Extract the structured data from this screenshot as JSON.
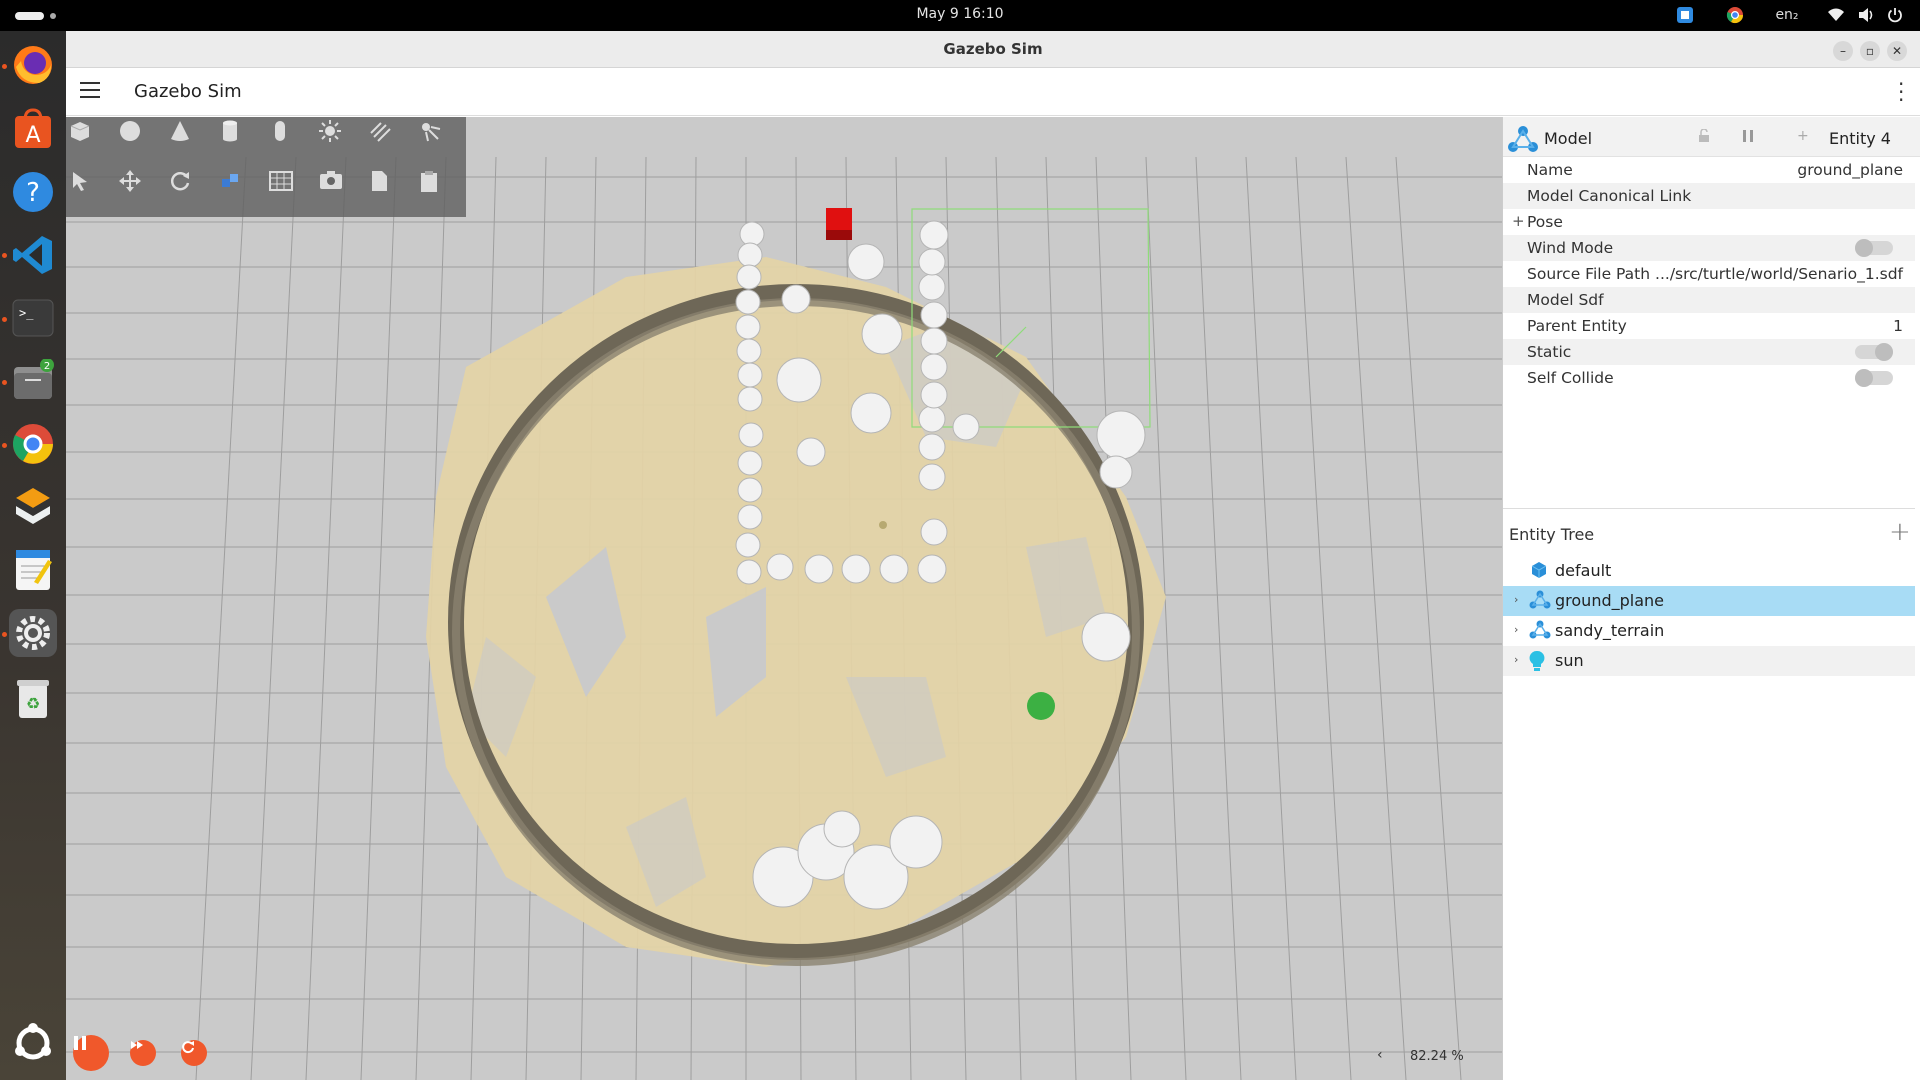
{
  "topbar": {
    "clock": "May 9  16:10",
    "lang": "en₂",
    "icons": [
      "screen-share-icon",
      "chrome-icon",
      "wifi-icon",
      "volume-icon",
      "power-icon"
    ]
  },
  "dock": {
    "apps": [
      {
        "name": "firefox",
        "running": true
      },
      {
        "name": "app-center",
        "running": false
      },
      {
        "name": "help",
        "running": false
      },
      {
        "name": "vscode",
        "running": true
      },
      {
        "name": "terminal",
        "running": true
      },
      {
        "name": "files",
        "running": true,
        "badge": "2"
      },
      {
        "name": "chrome",
        "running": true
      },
      {
        "name": "sublime-merge",
        "running": false
      },
      {
        "name": "text-editor",
        "running": false
      },
      {
        "name": "settings",
        "running": true
      },
      {
        "name": "trash",
        "running": false
      },
      {
        "name": "show-apps",
        "running": false
      }
    ]
  },
  "window": {
    "title": "Gazebo Sim",
    "app_title": "Gazebo Sim"
  },
  "scene": {
    "zoom": "82.24 %",
    "zoom_chevron": "‹"
  },
  "component_inspector": {
    "title": "Model",
    "entity": "Entity 4",
    "properties": [
      {
        "label": "Name",
        "value": "ground_plane"
      },
      {
        "label": "Model Canonical Link",
        "value": ""
      },
      {
        "label": "Pose",
        "value": "",
        "expand": "+"
      },
      {
        "label": "Wind Mode",
        "value": "",
        "toggle": false
      },
      {
        "label": "Source File Path",
        "value": ".../src/turtle/world/Senario_1.sdf"
      },
      {
        "label": "Model Sdf",
        "value": ""
      },
      {
        "label": "Parent Entity",
        "value": "1"
      },
      {
        "label": "Static",
        "value": "",
        "toggle": true
      },
      {
        "label": "Self Collide",
        "value": "",
        "toggle": false
      }
    ]
  },
  "entity_tree": {
    "title": "Entity Tree",
    "add": "+",
    "items": [
      {
        "label": "default",
        "icon": "world-icon",
        "expandable": false,
        "selected": false
      },
      {
        "label": "ground_plane",
        "icon": "model-icon",
        "expandable": true,
        "selected": true
      },
      {
        "label": "sandy_terrain",
        "icon": "model-icon",
        "expandable": true,
        "selected": false
      },
      {
        "label": "sun",
        "icon": "light-icon",
        "expandable": true,
        "selected": false
      }
    ]
  },
  "colors": {
    "accent": "#f0582b",
    "selection": "#a8dcf5",
    "sand": "#e6d7ae",
    "wall": "#7b7363",
    "red_box": "#e01010",
    "green_ball": "#3cb043"
  }
}
